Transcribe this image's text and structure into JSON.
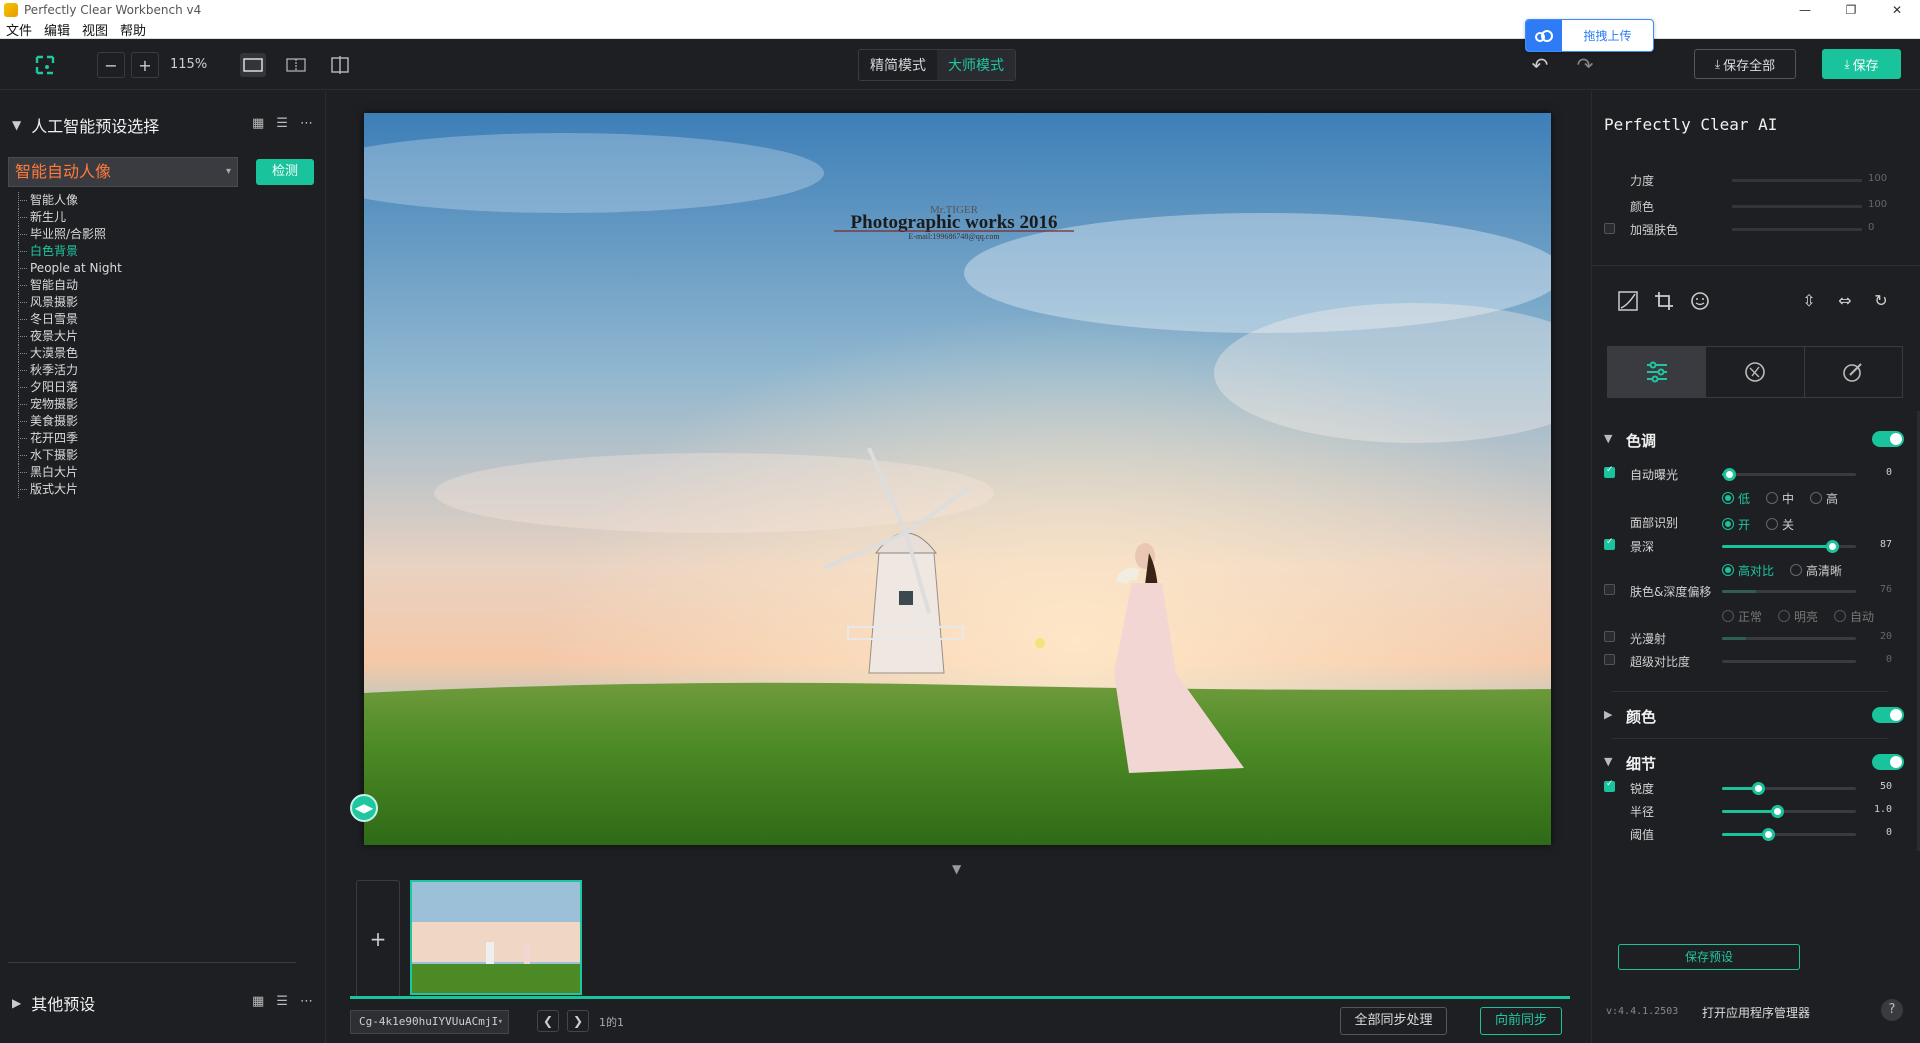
{
  "window": {
    "title": "Perfectly Clear Workbench v4",
    "controls": [
      "—",
      "❐",
      "✕"
    ]
  },
  "menu": [
    "文件",
    "编辑",
    "视图",
    "帮助"
  ],
  "upload_widget": {
    "label": "拖拽上传"
  },
  "toolbar": {
    "zoom_out": "−",
    "zoom_in": "+",
    "zoom_value": "115%",
    "modes": [
      "精简模式",
      "大师模式"
    ],
    "active_mode": "大师模式",
    "save_all": "保存全部",
    "save": "保存"
  },
  "left_panel": {
    "ai_section_title": "人工智能预设选择",
    "preset_selected": "智能自动人像",
    "detect_button": "检测",
    "presets": [
      "智能人像",
      "新生儿",
      "毕业照/合影照",
      "白色背景",
      "People at Night",
      "智能自动",
      "风景摄影",
      "冬日雪景",
      "夜景大片",
      "大漠景色",
      "秋季活力",
      "夕阳日落",
      "宠物摄影",
      "美食摄影",
      "花开四季",
      "水下摄影",
      "黑白大片",
      "版式大片"
    ],
    "selected_preset": "白色背景",
    "other_section_title": "其他预设"
  },
  "photo": {
    "watermark_title": "Photographic works 2016",
    "watermark_sub": "Mr.TIGER",
    "watermark_email": "E-mail:199686748@qq.com"
  },
  "filmstrip": {
    "add_button": "+",
    "file_name": "Cg-4k1e90huIYVUuACmjI",
    "page_indicator": "1的1",
    "sync_all": "全部同步处理",
    "sync_forward": "向前同步"
  },
  "right_panel": {
    "title": "Perfectly Clear AI",
    "top_sliders": [
      {
        "label": "力度",
        "value": "100"
      },
      {
        "label": "颜色",
        "value": "100"
      },
      {
        "label": "加强肤色",
        "value": "0"
      }
    ],
    "sections": {
      "tone": {
        "title": "色调",
        "auto_exposure": {
          "label": "自动曝光",
          "value": "0",
          "level": 0.05
        },
        "exposure_levels": [
          "低",
          "中",
          "高"
        ],
        "face_detect": {
          "label": "面部识别",
          "options": [
            "开",
            "关"
          ]
        },
        "depth": {
          "label": "景深",
          "value": "87",
          "level": 0.82
        },
        "depth_modes": [
          "高对比",
          "高清晰"
        ],
        "skin_depth": {
          "label": "肤色&深度偏移",
          "value": "76",
          "level": 0.25
        },
        "skin_modes": [
          "正常",
          "明亮",
          "自动"
        ],
        "light_diffusion": {
          "label": "光漫射",
          "value": "20",
          "level": 0.18
        },
        "super_contrast": {
          "label": "超级对比度",
          "value": "0",
          "level": 0.0
        }
      },
      "color": {
        "title": "颜色"
      },
      "detail": {
        "title": "细节",
        "sharpness": {
          "label": "锐度",
          "value": "50",
          "level": 0.27
        },
        "radius": {
          "label": "半径",
          "value": "1.0",
          "level": 0.41
        },
        "threshold": {
          "label": "阈值",
          "value": "0",
          "level": 0.34
        }
      }
    },
    "save_preset": "保存预设",
    "version": "v:4.4.1.2503",
    "open_manager": "打开应用程序管理器",
    "help": "?"
  }
}
